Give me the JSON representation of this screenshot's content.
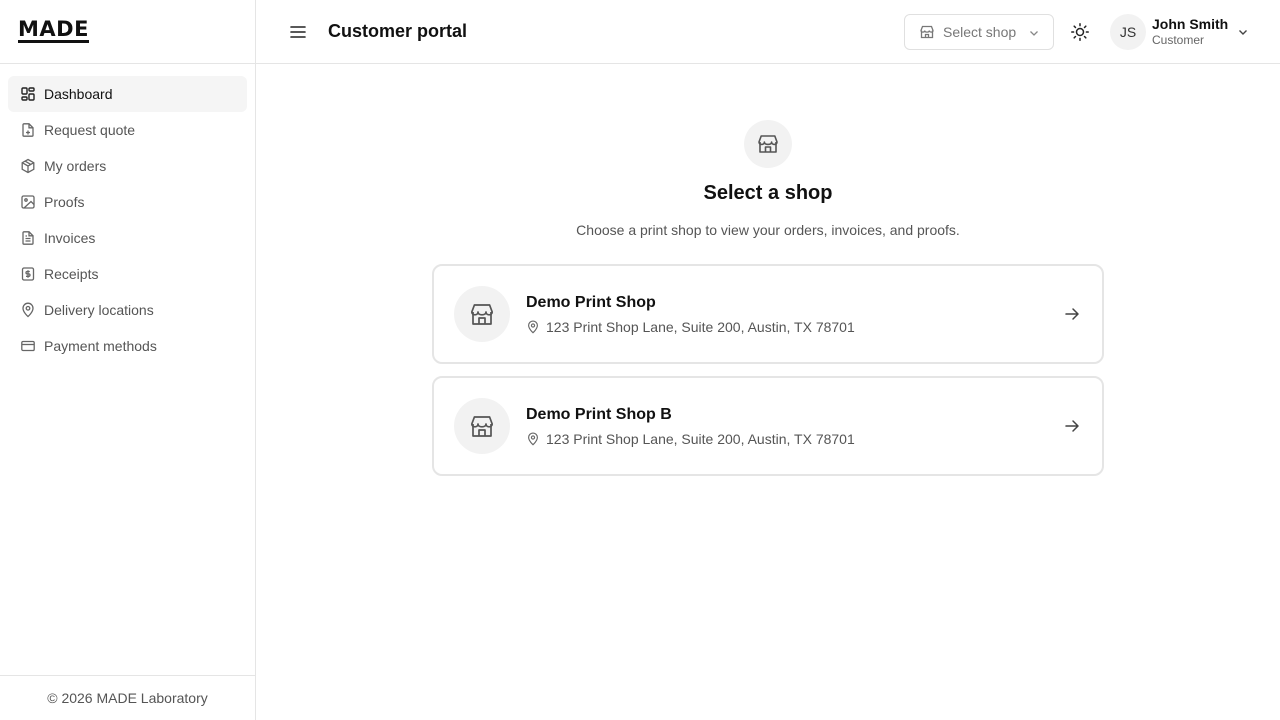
{
  "brand": {
    "logo": "MADE"
  },
  "sidebar": {
    "items": [
      {
        "label": "Dashboard",
        "icon": "dashboard-icon",
        "active": true
      },
      {
        "label": "Request quote",
        "icon": "file-plus-icon"
      },
      {
        "label": "My orders",
        "icon": "package-icon"
      },
      {
        "label": "Proofs",
        "icon": "image-icon"
      },
      {
        "label": "Invoices",
        "icon": "file-text-icon"
      },
      {
        "label": "Receipts",
        "icon": "receipt-icon"
      },
      {
        "label": "Delivery locations",
        "icon": "map-pin-icon"
      },
      {
        "label": "Payment methods",
        "icon": "credit-card-icon"
      }
    ],
    "footer": "© 2026 MADE Laboratory"
  },
  "header": {
    "title": "Customer portal",
    "shop_select_placeholder": "Select shop",
    "user": {
      "initials": "JS",
      "name": "John Smith",
      "role": "Customer"
    }
  },
  "main": {
    "title": "Select a shop",
    "subtitle": "Choose a print shop to view your orders, invoices, and proofs.",
    "shops": [
      {
        "name": "Demo Print Shop",
        "address": "123 Print Shop Lane, Suite 200, Austin, TX 78701"
      },
      {
        "name": "Demo Print Shop B",
        "address": "123 Print Shop Lane, Suite 200, Austin, TX 78701"
      }
    ]
  },
  "colors": {
    "border": "#e5e5e5",
    "muted": "#555555",
    "text": "#111111",
    "active_bg": "#f5f5f5"
  }
}
